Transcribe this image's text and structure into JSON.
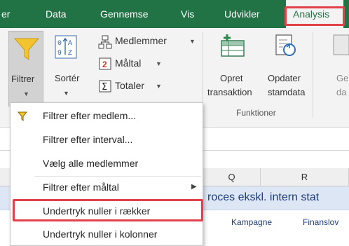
{
  "tabs": [
    {
      "label": "er",
      "active": false
    },
    {
      "label": "Data",
      "active": false
    },
    {
      "label": "Gennemse",
      "active": false
    },
    {
      "label": "Vis",
      "active": false
    },
    {
      "label": "Udvikler",
      "active": false
    },
    {
      "label": "Analysis",
      "active": true
    }
  ],
  "ribbon": {
    "filter_label": "Filtrer",
    "sort_label": "Sortér",
    "members_label": "Medlemmer",
    "measures_label": "Måltal",
    "totals_label": "Totaler",
    "create_transaction_line1": "Opret",
    "create_transaction_line2": "transaktion",
    "update_masterdata_line1": "Opdater",
    "update_masterdata_line2": "stamdata",
    "cut_button_line1": "Ge",
    "cut_button_line2": "da",
    "functions_group_label": "Funktioner"
  },
  "sheet": {
    "columns": [
      "Q",
      "R"
    ],
    "banner_text": "roces ekskl. intern stat",
    "row_text_1": "Kampagne",
    "row_text_2": "Finanslov"
  },
  "menu": {
    "items": [
      {
        "label": "Filtrer efter medlem...",
        "has_icon": true
      },
      {
        "label": "Filtrer efter interval...",
        "has_icon": false
      },
      {
        "label": "Vælg alle medlemmer",
        "has_icon": false
      },
      {
        "label": "Filtrer efter måltal",
        "has_icon": false,
        "has_submenu": true
      },
      {
        "label": "Undertryk nuller i rækker",
        "has_icon": false,
        "highlighted": true
      },
      {
        "label": "Undertryk nuller i kolonner",
        "has_icon": false
      }
    ]
  },
  "colors": {
    "ribbon_green": "#217346",
    "highlight_red": "#e0414a",
    "banner_blue": "#dde6f4",
    "filter_yellow": "#f4c430"
  },
  "icons": [
    "filter-funnel-icon",
    "sort-az-icon",
    "members-hierarchy-icon",
    "measures-icon",
    "totals-sigma-icon",
    "create-transaction-icon",
    "update-masterdata-icon",
    "submenu-arrow-icon"
  ]
}
